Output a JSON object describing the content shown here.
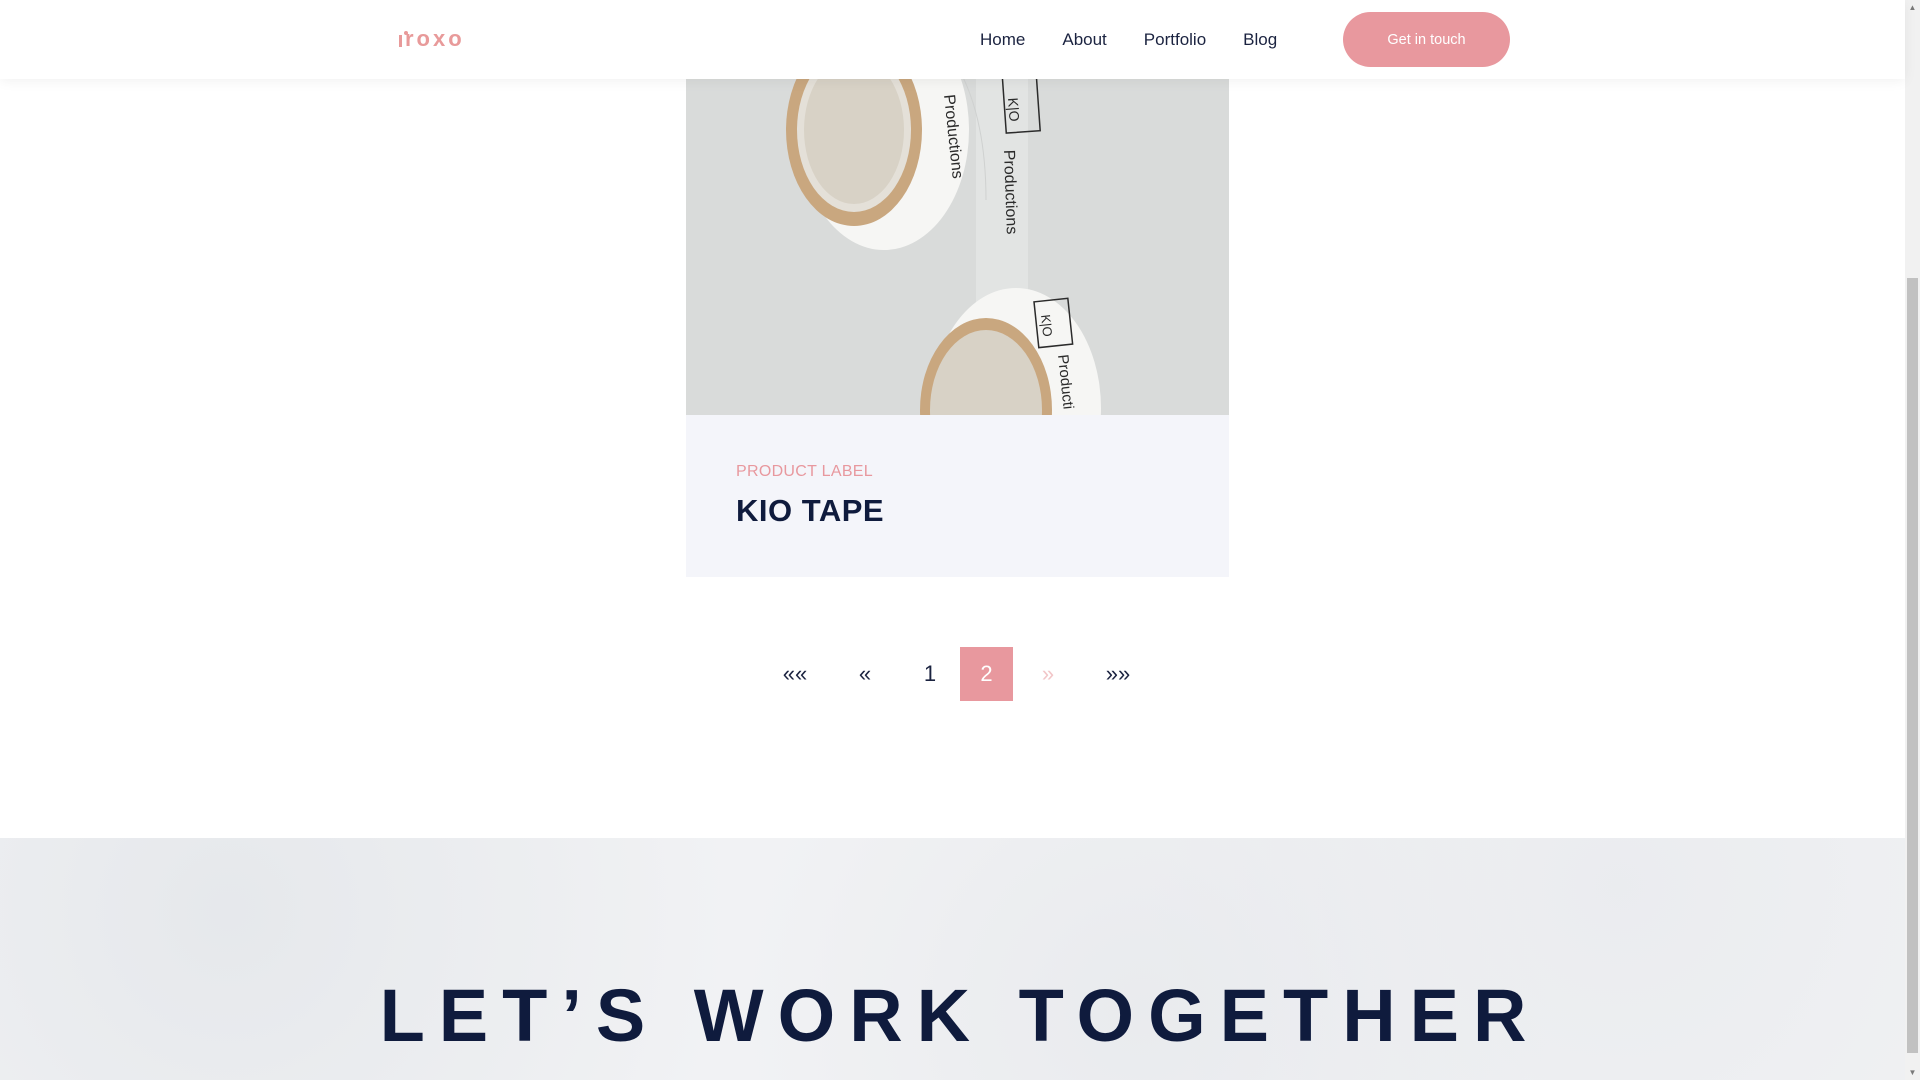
{
  "header": {
    "logo_text": "roxo",
    "nav": [
      "Home",
      "About",
      "Portfolio",
      "Blog"
    ],
    "cta_label": "Get in touch"
  },
  "portfolio": {
    "card": {
      "category": "PRODUCT LABEL",
      "title": "KIO TAPE",
      "image_text": {
        "top_label": "K|O",
        "tape_text_1": "Productions",
        "tape_text_2": "Productions",
        "bottom_label": "K|O",
        "bottom_text": "Producti"
      }
    }
  },
  "pagination": {
    "first": "««",
    "prev": "«",
    "pages": [
      "1",
      "2"
    ],
    "current": "2",
    "next": "»",
    "last": "»»"
  },
  "footer": {
    "title": "LET’S WORK TOGETHER"
  },
  "colors": {
    "accent": "#e8989e",
    "navy": "#0f1b3d",
    "card_bg": "#f4f5fa"
  }
}
